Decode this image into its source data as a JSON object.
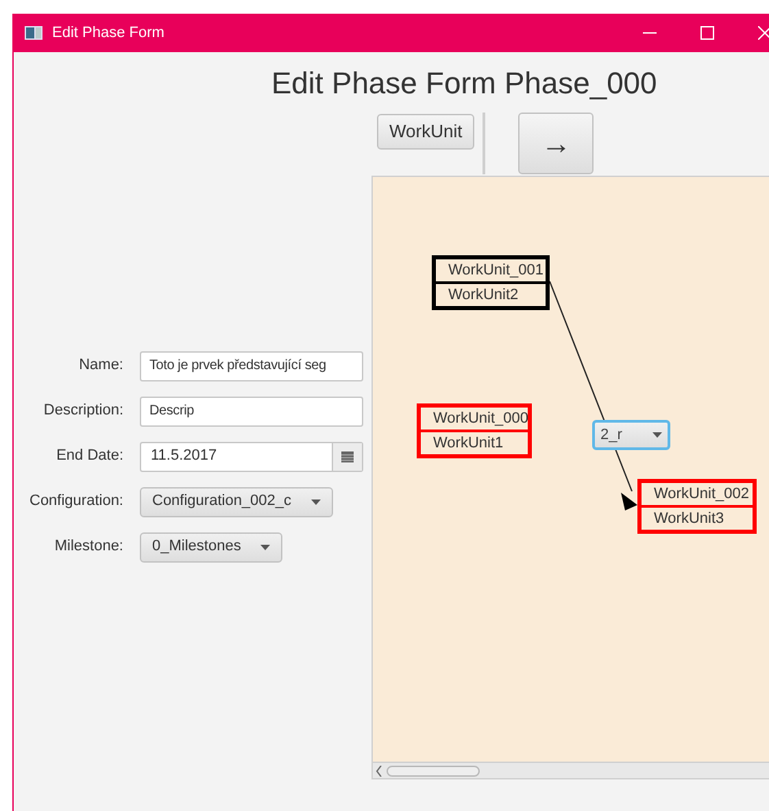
{
  "window": {
    "title": "Edit Phase Form"
  },
  "heading": "Edit Phase Form Phase_000",
  "toolbar": {
    "workunit_button": "WorkUnit",
    "arrow_button": "→"
  },
  "form": [
    {
      "label": "Name:",
      "kind": "text",
      "value": "Toto je prvek představující seg"
    },
    {
      "label": "Description:",
      "kind": "text",
      "value": "Descrip"
    },
    {
      "label": "End Date:",
      "kind": "date",
      "value": "11.5.2017"
    },
    {
      "label": "Configuration:",
      "kind": "select",
      "value": "Configuration_002_c"
    },
    {
      "label": "Milestone:",
      "kind": "select",
      "value": "0_Milestones"
    }
  ],
  "canvas": {
    "nodes": [
      {
        "title": "WorkUnit_001",
        "name": "WorkUnit2",
        "color": "#000000"
      },
      {
        "title": "WorkUnit_000",
        "name": "WorkUnit1",
        "color": "#ff0000"
      },
      {
        "title": "WorkUnit_002",
        "name": "WorkUnit3",
        "color": "#ff0000"
      }
    ],
    "combo": {
      "value": "2_r"
    }
  }
}
